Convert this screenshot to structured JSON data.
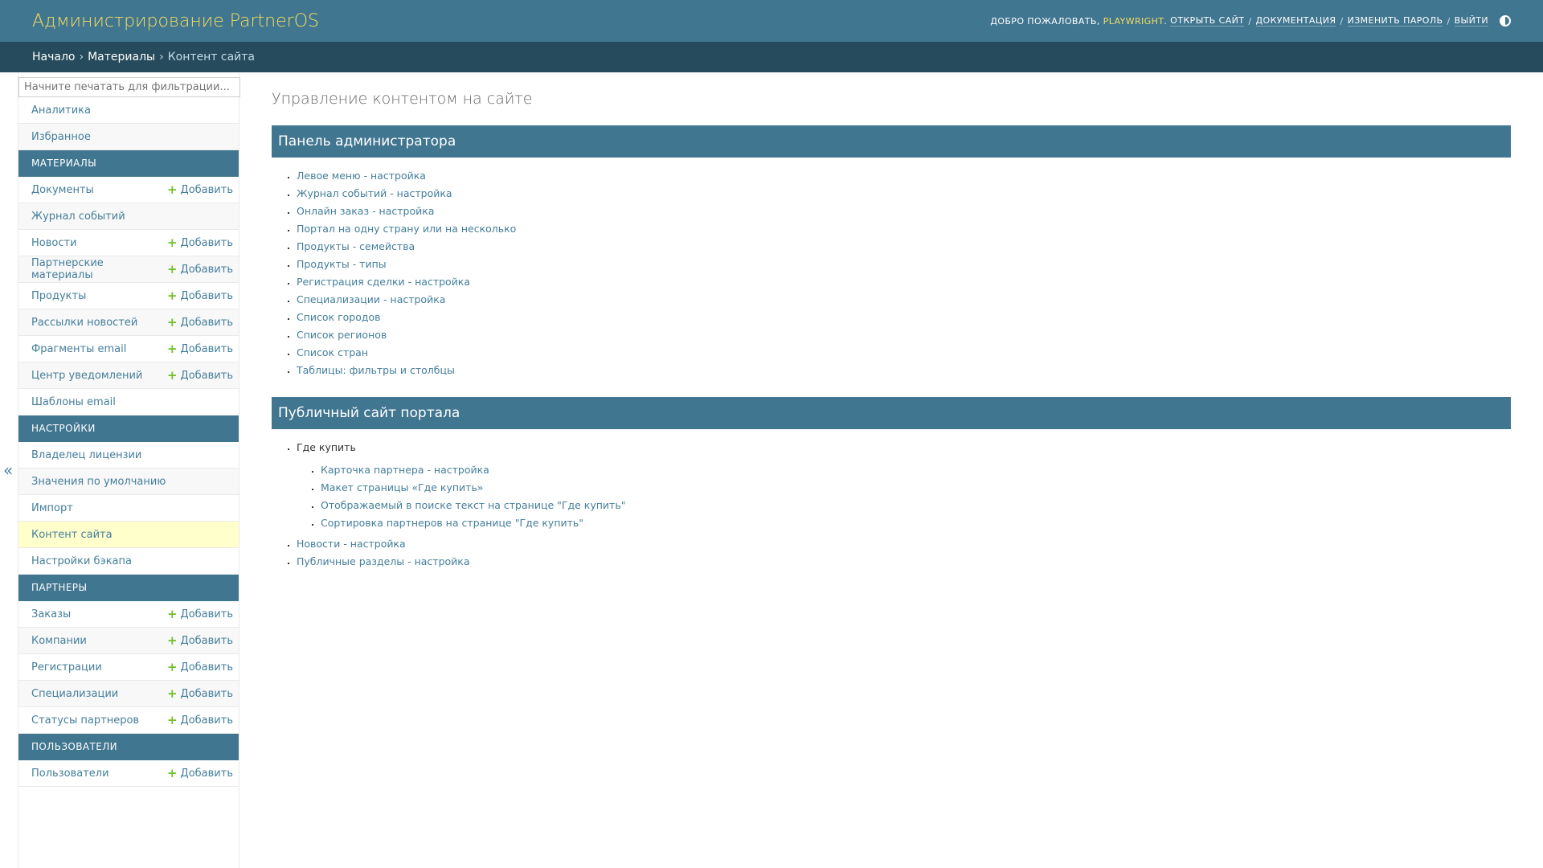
{
  "header": {
    "brand": "Администрирование PartnerOS",
    "welcome": "Добро пожаловать,",
    "username": "playwright",
    "open_site": "Открыть сайт",
    "docs": "Документация",
    "change_password": "Изменить пароль",
    "logout": "Выйти"
  },
  "breadcrumbs": {
    "home": "Начало",
    "materials": "Материалы",
    "current": "Контент сайта"
  },
  "sidebar": {
    "filter_placeholder": "Начните печатать для фильтрации...",
    "collapse_icon": "«",
    "add_label": "Добавить",
    "top_items": [
      "Аналитика",
      "Избранное"
    ],
    "modules": [
      {
        "caption": "Материалы",
        "items": [
          {
            "label": "Документы",
            "add": true
          },
          {
            "label": "Журнал событий",
            "add": false
          },
          {
            "label": "Новости",
            "add": true
          },
          {
            "label": "Партнерские материалы",
            "add": true
          },
          {
            "label": "Продукты",
            "add": true
          },
          {
            "label": "Рассылки новостей",
            "add": true
          },
          {
            "label": "Фрагменты email",
            "add": true
          },
          {
            "label": "Центр уведомлений",
            "add": true
          },
          {
            "label": "Шаблоны email",
            "add": false
          }
        ]
      },
      {
        "caption": "Настройки",
        "items": [
          {
            "label": "Владелец лицензии",
            "add": false
          },
          {
            "label": "Значения по умолчанию",
            "add": false
          },
          {
            "label": "Импорт",
            "add": false
          },
          {
            "label": "Контент сайта",
            "add": false,
            "current": true
          },
          {
            "label": "Настройки бэкапа",
            "add": false
          }
        ]
      },
      {
        "caption": "Партнеры",
        "items": [
          {
            "label": "Заказы",
            "add": true
          },
          {
            "label": "Компании",
            "add": true
          },
          {
            "label": "Регистрации",
            "add": true
          },
          {
            "label": "Специализации",
            "add": true
          },
          {
            "label": "Статусы партнеров",
            "add": true
          }
        ]
      },
      {
        "caption": "Пользователи",
        "items": [
          {
            "label": "Пользователи",
            "add": true
          }
        ]
      }
    ]
  },
  "content": {
    "title": "Управление контентом на сайте",
    "admin_panel": {
      "heading": "Панель администратора",
      "links": [
        "Левое меню - настройка",
        "Журнал событий - настройка",
        "Онлайн заказ - настройка",
        "Портал на одну страну или на несколько",
        "Продукты - семейства",
        "Продукты - типы",
        "Регистрация сделки - настройка",
        "Специализации - настройка",
        "Список городов",
        "Список регионов",
        "Список стран",
        "Таблицы: фильтры и столбцы"
      ]
    },
    "public_site": {
      "heading": "Публичный сайт портала",
      "where_to_buy": "Где купить",
      "where_to_buy_links": [
        "Карточка партнера - настройка",
        "Макет страницы «Где купить»",
        "Отображаемый в поиске текст на странице \"Где купить\"",
        "Сортировка партнеров на странице \"Где купить\""
      ],
      "links": [
        "Новости - настройка",
        "Публичные разделы - настройка"
      ]
    }
  }
}
